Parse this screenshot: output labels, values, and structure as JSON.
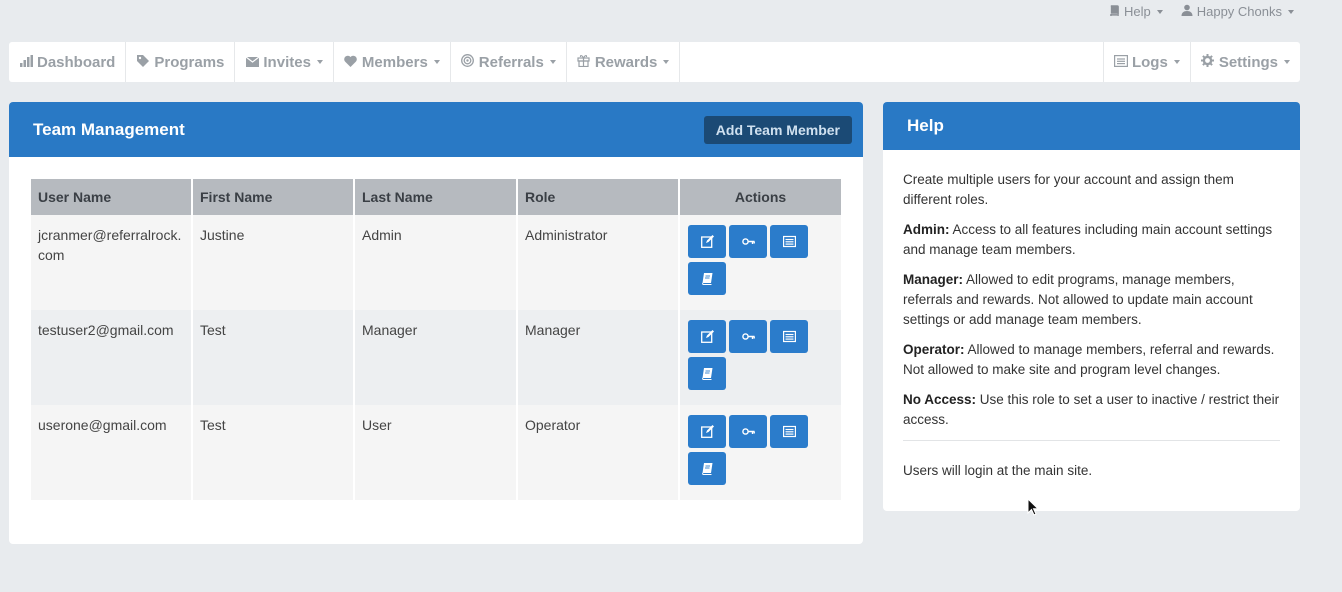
{
  "topbar": {
    "help_label": "Help",
    "user_label": "Happy Chonks",
    "help_icon": "book-icon",
    "user_icon": "user-icon"
  },
  "nav": {
    "left": [
      {
        "label": "Dashboard",
        "icon": "bar-chart-icon",
        "dropdown": false
      },
      {
        "label": "Programs",
        "icon": "tag-icon",
        "dropdown": false
      },
      {
        "label": "Invites",
        "icon": "envelope-icon",
        "dropdown": true
      },
      {
        "label": "Members",
        "icon": "heart-icon",
        "dropdown": true
      },
      {
        "label": "Referrals",
        "icon": "target-icon",
        "dropdown": true
      },
      {
        "label": "Rewards",
        "icon": "gift-icon",
        "dropdown": true
      }
    ],
    "right": [
      {
        "label": "Logs",
        "icon": "list-icon",
        "dropdown": true
      },
      {
        "label": "Settings",
        "icon": "gear-icon",
        "dropdown": true
      }
    ]
  },
  "team": {
    "title": "Team Management",
    "add_label": "Add Team Member",
    "columns": [
      "User Name",
      "First Name",
      "Last Name",
      "Role",
      "Actions"
    ],
    "rows": [
      {
        "username": "jcranmer@referralrock.\ncom",
        "first": "Justine",
        "last": "Admin",
        "role": "Administrator"
      },
      {
        "username": "testuser2@gmail.com",
        "first": "Test",
        "last": "Manager",
        "role": "Manager"
      },
      {
        "username": "userone@gmail.com",
        "first": "Test",
        "last": "User",
        "role": "Operator"
      }
    ],
    "action_icons": [
      "edit-icon",
      "key-icon",
      "list-icon",
      "book-icon"
    ]
  },
  "help": {
    "title": "Help",
    "intro": "Create multiple users for your account and assign them different roles.",
    "roles": [
      {
        "name": "Admin:",
        "desc": " Access to all features including main account settings and manage team members."
      },
      {
        "name": "Manager:",
        "desc": " Allowed to edit programs, manage members, referrals and rewards. Not allowed to update main account settings or add manage team members."
      },
      {
        "name": "Operator:",
        "desc": " Allowed to manage members, referral and rewards. Not allowed to make site and program level changes."
      },
      {
        "name": "No Access:",
        "desc": " Use this role to set a user to inactive / restrict their access."
      }
    ],
    "footer": "Users will login at the main site."
  },
  "colors": {
    "accent": "#2979c5",
    "add_button": "#1b4a75",
    "action_button": "#2b7ccb",
    "background": "#e8ebee"
  }
}
